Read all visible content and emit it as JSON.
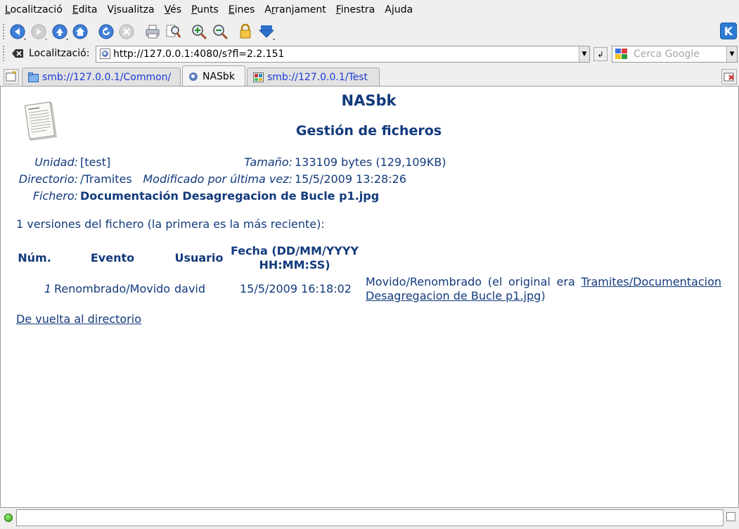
{
  "menu": [
    "Localització",
    "Edita",
    "Visualitza",
    "Vés",
    "Punts",
    "Eines",
    "Arranjament",
    "Finestra",
    "Ajuda"
  ],
  "menu_underline_index": [
    0,
    0,
    1,
    0,
    0,
    0,
    1,
    0,
    1
  ],
  "location": {
    "label": "Localització:",
    "url": "http://127.0.0.1:4080/s?fl=2.2.151",
    "search_placeholder": "Cerca Google"
  },
  "tabs": [
    {
      "label": "smb://127.0.0.1/Common/",
      "active": false
    },
    {
      "label": "NASbk",
      "active": true
    },
    {
      "label": "smb://127.0.0.1/Test",
      "active": false
    }
  ],
  "page": {
    "title": "NASbk",
    "subtitle": "Gestión de ficheros",
    "fields": {
      "unidad_label": "Unidad:",
      "unidad_value": "[test]",
      "tamano_label": "Tamaño:",
      "tamano_value": "133109 bytes (129,109KB)",
      "directorio_label": "Directorio:",
      "directorio_value": "/Tramites",
      "modificado_label": "Modificado por última vez:",
      "modificado_value": "15/5/2009 13:28:26",
      "fichero_label": "Fichero:",
      "fichero_value": "Documentación Desagregacion de Bucle p1.jpg"
    },
    "versions_text": "1 versiones del fichero (la primera es la más reciente):",
    "table": {
      "headers": [
        "Núm.",
        "Evento",
        "Usuario",
        "Fecha (DD/MM/YYYY",
        "HH:MM:SS)"
      ],
      "rows": [
        {
          "num": "1",
          "evento": "Renombrado/Movido",
          "usuario": "david",
          "fecha": "15/5/2009 16:18:02",
          "detail_prefix": "Movido/Renombrado (el original era",
          "detail_link_1": "Tramites/Documentacion",
          "detail_link_2": "Desagregacion de Bucle p1.jpg",
          "detail_suffix": ")"
        }
      ]
    },
    "back_link": "De vuelta al directorio"
  },
  "colors": {
    "content_text": "#123a7c",
    "tab_link": "#1a3bd6"
  }
}
